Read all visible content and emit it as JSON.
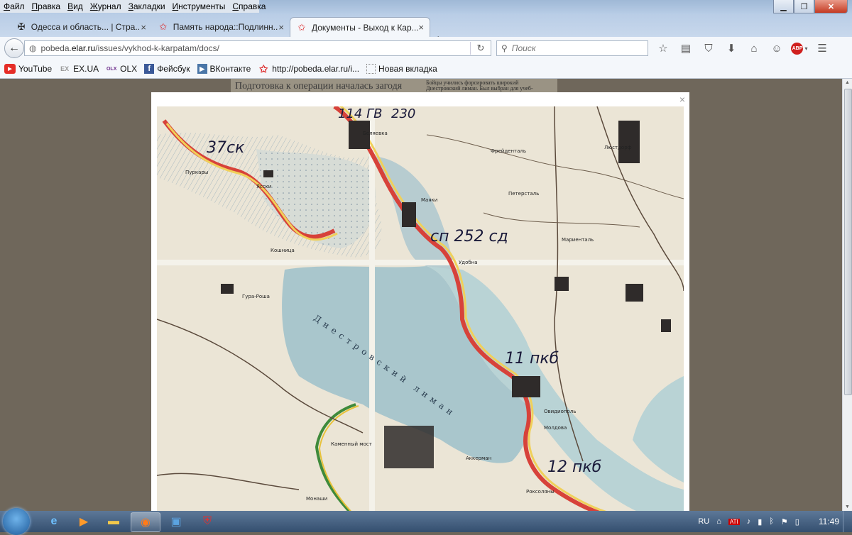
{
  "menu": [
    "Файл",
    "Правка",
    "Вид",
    "Журнал",
    "Закладки",
    "Инструменты",
    "Справка"
  ],
  "tabs": [
    {
      "label": "Одесса и область... | Стра...",
      "icon": "cross-icon",
      "close": "×"
    },
    {
      "label": "Память народа::Подлинн...",
      "icon": "red-star-icon",
      "close": "×"
    },
    {
      "label": "Документы - Выход к Кар...",
      "icon": "red-star-icon",
      "close": "×",
      "active": true
    }
  ],
  "newtab": "+",
  "nav": {
    "back": "←",
    "url_domain": "pobeda.",
    "url_domain_bold": "elar.ru",
    "url_path": "/issues/vykhod-k-karpatam/docs/",
    "reload": "↻",
    "search_placeholder": "Поиск"
  },
  "toolbar_icons": [
    "star-icon",
    "reading-list-icon",
    "pocket-icon",
    "download-icon",
    "home-icon",
    "chat-icon",
    "abp-icon",
    "menu-icon"
  ],
  "abp_label": "ABP",
  "bookmarks": [
    {
      "label": "YouTube",
      "icon": "youtube-icon"
    },
    {
      "label": "EX.UA",
      "icon": "ex-ua-icon",
      "icontext": "EX"
    },
    {
      "label": "OLX",
      "icon": "olx-icon",
      "icontext": "OLX"
    },
    {
      "label": "Фейсбук",
      "icon": "facebook-icon",
      "icontext": "f"
    },
    {
      "label": "ВКонтакте",
      "icon": "vk-icon"
    },
    {
      "label": "http://pobeda.elar.ru/i...",
      "icon": "red-star-icon"
    },
    {
      "label": "Новая вкладка",
      "icon": "blank-page-icon"
    }
  ],
  "page": {
    "bg_heading": "Подготовка к операции началась загодя",
    "bg_small_1": "Бойцы учились форсировать широкий",
    "bg_small_2": "Днестровский лиман. Был выбран для учеб-",
    "lightbox_close": "×"
  },
  "map": {
    "annotations": [
      "37ск",
      "114 ГВ",
      "230",
      "сп 252 сд",
      "11 пкб",
      "12 пкб"
    ],
    "places": [
      "Маяки",
      "Удобна",
      "Гура-Роша",
      "Каменный мост",
      "Аккерман",
      "Овидиополь",
      "Молдова",
      "Роксоляны",
      "Беляевка",
      "Ясски",
      "Пуркары",
      "Кошница",
      "Фрейденталь",
      "Петерсталь",
      "Мариенталь",
      "Люстдорф",
      "Днестровский лиман",
      "Монаши"
    ]
  },
  "taskbar": {
    "apps": [
      "ie-icon",
      "media-player-icon",
      "explorer-icon",
      "firefox-icon",
      "save-icon",
      "shield-icon"
    ],
    "lang": "RU",
    "clock": "11:49"
  }
}
